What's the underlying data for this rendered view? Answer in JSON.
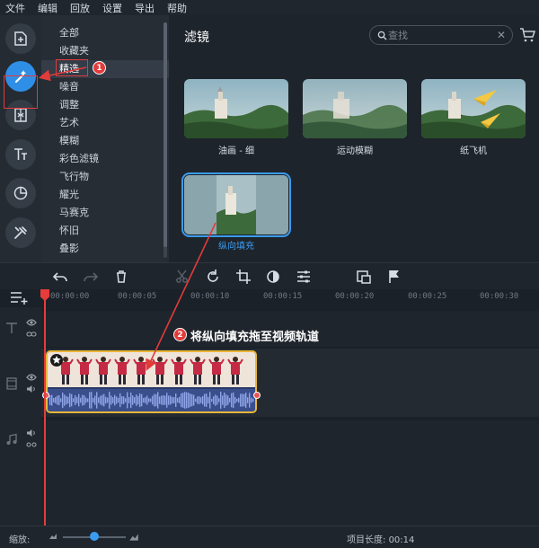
{
  "menu": [
    "文件",
    "编辑",
    "回放",
    "设置",
    "导出",
    "帮助"
  ],
  "categories": [
    "全部",
    "收藏夹",
    "精选",
    "噪音",
    "调整",
    "艺术",
    "模糊",
    "彩色滤镜",
    "飞行物",
    "耀光",
    "马赛克",
    "怀旧",
    "叠影"
  ],
  "selected_category": "精选",
  "filters_panel": {
    "title": "滤镜",
    "search_placeholder": "查找",
    "items": [
      {
        "label": "油画 - 细",
        "selected": false
      },
      {
        "label": "运动模糊",
        "selected": false
      },
      {
        "label": "纸飞机",
        "selected": false
      },
      {
        "label": "纵向填充",
        "selected": true
      }
    ]
  },
  "timeline": {
    "ruler_labels": [
      "00:00:00",
      "00:00:05",
      "00:00:10",
      "00:00:15",
      "00:00:20",
      "00:00:25",
      "00:00:30"
    ],
    "clip": {
      "name": "video-clip"
    }
  },
  "annotations": {
    "step1": "1",
    "step2": "2",
    "step2_text": "将纵向填充拖至视频轨道"
  },
  "bottom": {
    "zoom_label": "缩放:",
    "zoom_level": 0.5,
    "project_length_label": "项目长度:",
    "project_length": "00:14"
  },
  "colors": {
    "accent": "#3a9cf0",
    "annotation_red": "#e23b3b",
    "clip_border": "#e8b63a",
    "playhead": "#e63c3c"
  }
}
